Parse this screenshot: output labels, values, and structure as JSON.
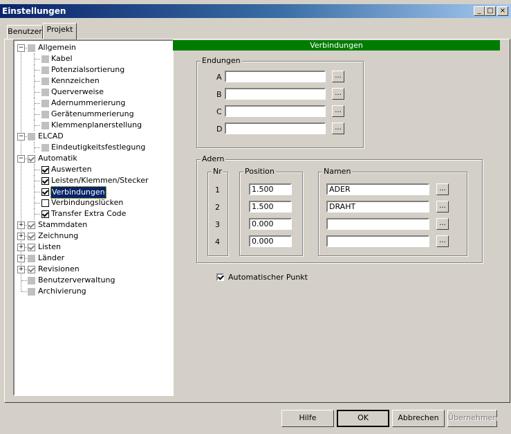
{
  "window": {
    "title": "Einstellungen",
    "min": "_",
    "max": "□",
    "close": "×"
  },
  "tabs": [
    {
      "label": "Benutzer"
    },
    {
      "label": "Projekt"
    }
  ],
  "tree": [
    {
      "label": "Allgemein",
      "level": 0,
      "expander": "-",
      "check": "gray"
    },
    {
      "label": "Kabel",
      "level": 1,
      "check": "gray"
    },
    {
      "label": "Potenzialsortierung",
      "level": 1,
      "check": "gray"
    },
    {
      "label": "Kennzeichen",
      "level": 1,
      "check": "gray"
    },
    {
      "label": "Querverweise",
      "level": 1,
      "check": "gray"
    },
    {
      "label": "Adernummerierung",
      "level": 1,
      "check": "gray"
    },
    {
      "label": "Gerätenummerierung",
      "level": 1,
      "check": "gray"
    },
    {
      "label": "Klemmenplanerstellung",
      "level": 1,
      "check": "gray"
    },
    {
      "label": "ELCAD",
      "level": 0,
      "expander": "-",
      "check": "gray"
    },
    {
      "label": "Eindeutigkeitsfestlegung",
      "level": 1,
      "check": "gray"
    },
    {
      "label": "Automatik",
      "level": 0,
      "expander": "-",
      "check": "grayc"
    },
    {
      "label": "Auswerten",
      "level": 1,
      "check": "on"
    },
    {
      "label": "Leisten/Klemmen/Stecker",
      "level": 1,
      "check": "on"
    },
    {
      "label": "Verbindungen",
      "level": 1,
      "check": "on",
      "selected": true
    },
    {
      "label": "Verbindungslücken",
      "level": 1,
      "check": "off"
    },
    {
      "label": "Transfer Extra Code",
      "level": 1,
      "check": "on"
    },
    {
      "label": "Stammdaten",
      "level": 0,
      "expander": "+",
      "check": "grayc"
    },
    {
      "label": "Zeichnung",
      "level": 0,
      "expander": "+",
      "check": "grayc"
    },
    {
      "label": "Listen",
      "level": 0,
      "expander": "+",
      "check": "grayc"
    },
    {
      "label": "Länder",
      "level": 0,
      "expander": "+",
      "check": "gray"
    },
    {
      "label": "Revisionen",
      "level": 0,
      "expander": "+",
      "check": "grayc"
    },
    {
      "label": "Benutzerverwaltung",
      "level": 0,
      "check": "gray"
    },
    {
      "label": "Archivierung",
      "level": 0,
      "check": "gray"
    }
  ],
  "panel": {
    "header": "Verbindungen",
    "endungen": {
      "title": "Endungen",
      "rows": [
        {
          "label": "A",
          "value": ""
        },
        {
          "label": "B",
          "value": ""
        },
        {
          "label": "C",
          "value": ""
        },
        {
          "label": "D",
          "value": ""
        }
      ]
    },
    "adern": {
      "title": "Adern",
      "nr_title": "Nr",
      "position_title": "Position",
      "namen_title": "Namen",
      "rows": [
        {
          "nr": "1",
          "position": "1.500",
          "name": "ADER"
        },
        {
          "nr": "2",
          "position": "1.500",
          "name": "DRAHT"
        },
        {
          "nr": "3",
          "position": "0.000",
          "name": ""
        },
        {
          "nr": "4",
          "position": "0.000",
          "name": ""
        }
      ]
    },
    "auto_punkt": {
      "label": "Automatischer Punkt",
      "checked": true
    },
    "ellipsis": "..."
  },
  "buttons": {
    "help": "Hilfe",
    "ok": "OK",
    "cancel": "Abbrechen",
    "apply": "Übernehmen"
  }
}
